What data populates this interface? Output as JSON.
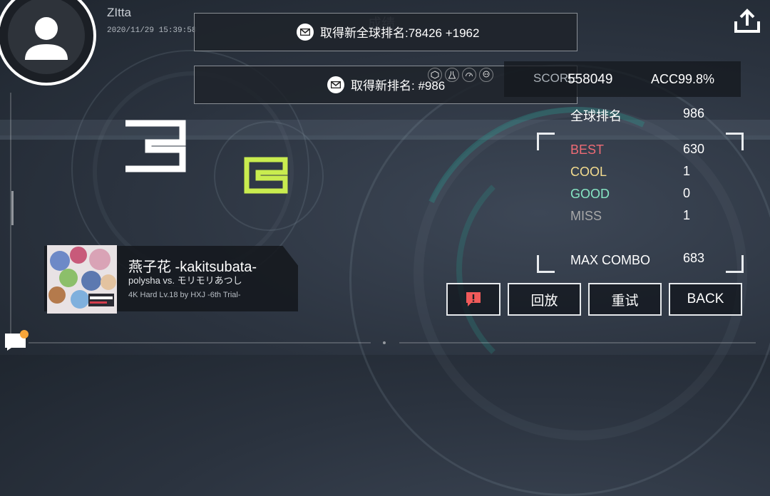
{
  "header": {
    "user_name": "ZItta",
    "timestamp": "2020/11/29 15:39:58",
    "title": "成绩"
  },
  "banners": [
    {
      "text": "取得新全球排名:78426 +1962"
    },
    {
      "text": "取得新排名: #986"
    }
  ],
  "grade": {
    "rank_digit": "3",
    "letter": "B"
  },
  "score": {
    "score_label": "SCORE",
    "score_value": "558049",
    "acc_label": "ACC.",
    "acc_value": "99.8%"
  },
  "stats": {
    "global_rank_label": "全球排名",
    "global_rank_value": "986",
    "best_label": "BEST",
    "best_value": "630",
    "cool_label": "COOL",
    "cool_value": "1",
    "good_label": "GOOD",
    "good_value": "0",
    "miss_label": "MISS",
    "miss_value": "1",
    "max_combo_label": "MAX COMBO",
    "max_combo_value": "683"
  },
  "song": {
    "title": "燕子花 -kakitsubata-",
    "artist": "polysha vs. モリモリあつし",
    "difficulty": "4K Hard  Lv.18 by HXJ -6th Trial-"
  },
  "buttons": {
    "report_icon": "alert-icon",
    "replay": "回放",
    "retry": "重试",
    "back": "BACK"
  },
  "colors": {
    "best": "#ee6b75",
    "cool": "#f4dc8f",
    "good": "#86e5c3",
    "miss": "#a8a8a8",
    "grade_letter": "#c9ec4f",
    "report": "#f05a5a",
    "notification_dot": "#f6a53a"
  }
}
